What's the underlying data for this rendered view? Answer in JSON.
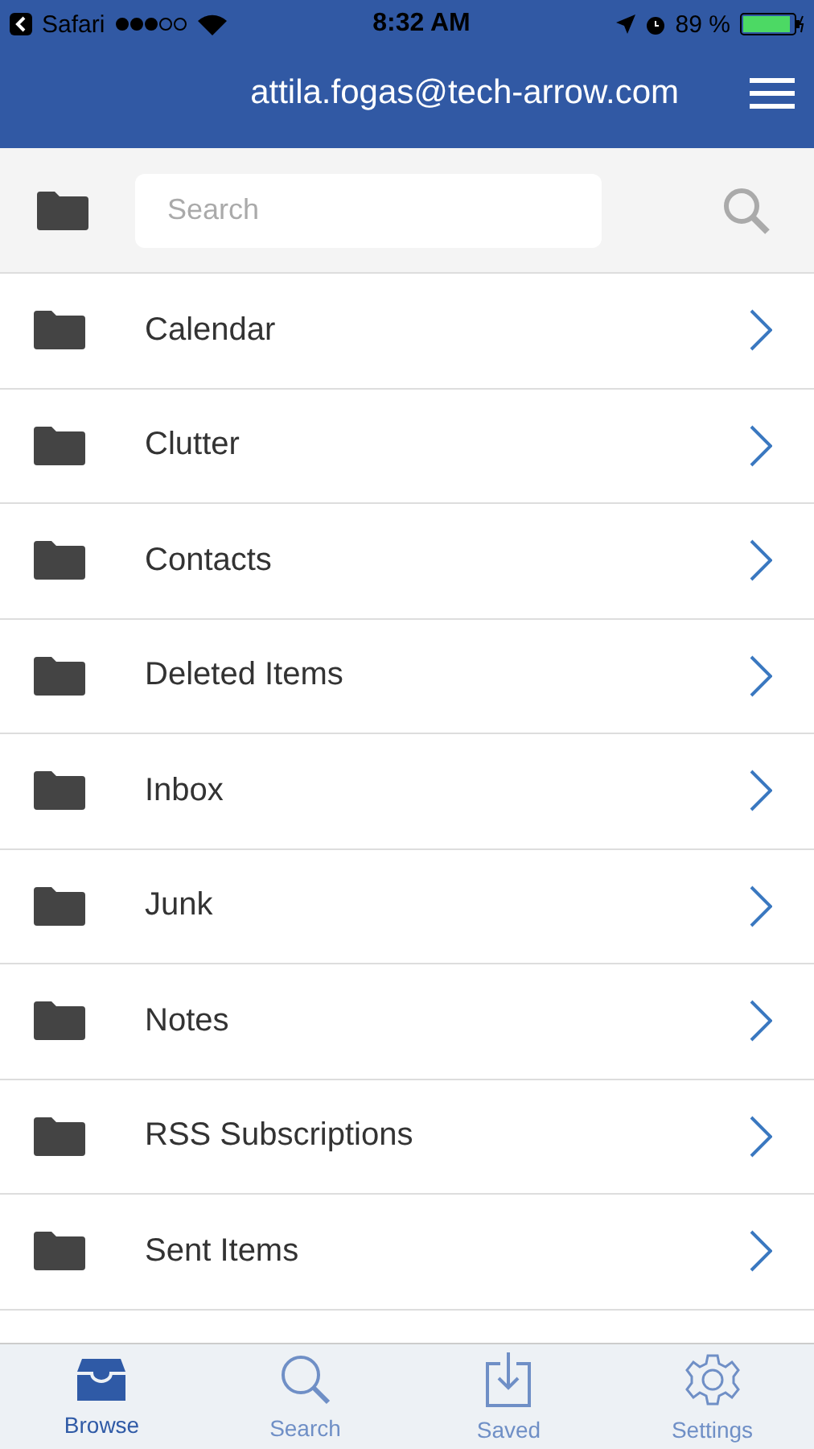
{
  "status_bar": {
    "back_app": "Safari",
    "time": "8:32 AM",
    "battery": "89 %"
  },
  "header": {
    "title": "attila.fogas@tech-arrow.com"
  },
  "search": {
    "placeholder": "Search"
  },
  "folders": [
    {
      "name": "Calendar"
    },
    {
      "name": "Clutter"
    },
    {
      "name": "Contacts"
    },
    {
      "name": "Deleted Items"
    },
    {
      "name": "Inbox"
    },
    {
      "name": "Junk"
    },
    {
      "name": "Notes"
    },
    {
      "name": "RSS Subscriptions"
    },
    {
      "name": "Sent Items"
    }
  ],
  "tabs": [
    {
      "kind": "browse",
      "label": "Browse",
      "selected": true
    },
    {
      "kind": "search",
      "label": "Search",
      "selected": false
    },
    {
      "kind": "saved",
      "label": "Saved",
      "selected": false
    },
    {
      "kind": "settings",
      "label": "Settings",
      "selected": false
    }
  ]
}
